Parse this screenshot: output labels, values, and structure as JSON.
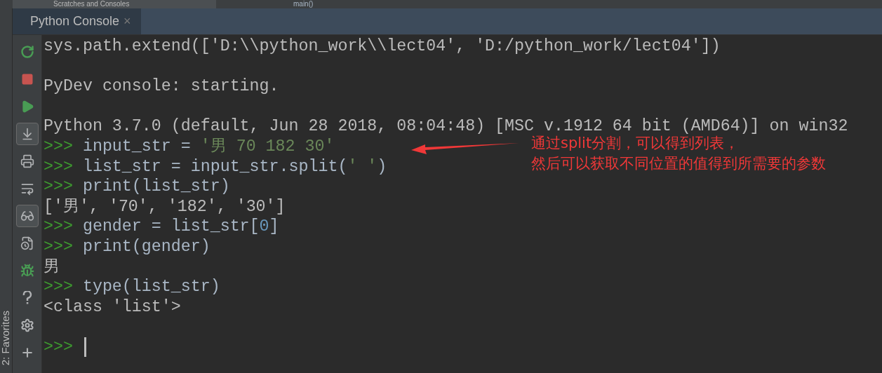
{
  "top_strip": {
    "tree_item": "Scratches and Consoles",
    "editor_text": "main()"
  },
  "tab": {
    "label": "Python Console",
    "close": "×",
    "selected": true
  },
  "toolbar": [
    {
      "kind": "rerun",
      "selected": false
    },
    {
      "kind": "stop",
      "selected": false
    },
    {
      "kind": "run",
      "selected": false
    },
    {
      "kind": "scroll-end",
      "selected": true
    },
    {
      "kind": "print",
      "selected": false
    },
    {
      "kind": "wrap",
      "selected": false
    },
    {
      "kind": "variables",
      "selected": true
    },
    {
      "kind": "history",
      "selected": false
    },
    {
      "kind": "debug",
      "selected": false
    },
    {
      "kind": "help",
      "selected": false
    },
    {
      "kind": "settings",
      "selected": false
    },
    {
      "kind": "add",
      "selected": false
    }
  ],
  "side_label": "2: Favorites",
  "console_blocks": [
    {
      "lines": [
        [
          {
            "kind": "output",
            "text": "sys.path.extend(['D:\\\\python_work\\\\lect04', 'D:/python_work/lect04'])"
          }
        ]
      ]
    },
    {
      "lines": [
        [
          {
            "kind": "output",
            "text": "PyDev console: starting."
          }
        ]
      ]
    },
    {
      "lines": [
        [
          {
            "kind": "output",
            "text": "Python 3.7.0 (default, Jun 28 2018, 08:04:48) [MSC v.1912 64 bit (AMD64)] on win32"
          }
        ],
        [
          {
            "kind": "prompt",
            "text": ">>>"
          },
          {
            "kind": "code",
            "text": " input_str = "
          },
          {
            "kind": "string",
            "text": "'男 70 182 30'"
          }
        ],
        [
          {
            "kind": "prompt",
            "text": ">>>"
          },
          {
            "kind": "code",
            "text": " list_str = input_str.split("
          },
          {
            "kind": "string",
            "text": "' '"
          },
          {
            "kind": "code",
            "text": ")"
          }
        ],
        [
          {
            "kind": "prompt",
            "text": ">>>"
          },
          {
            "kind": "code",
            "text": " print(list_str)"
          }
        ],
        [
          {
            "kind": "output",
            "text": "['男', '70', '182', '30']"
          }
        ],
        [
          {
            "kind": "prompt",
            "text": ">>>"
          },
          {
            "kind": "code",
            "text": " gender = list_str["
          },
          {
            "kind": "number",
            "text": "0"
          },
          {
            "kind": "code",
            "text": "]"
          }
        ],
        [
          {
            "kind": "prompt",
            "text": ">>>"
          },
          {
            "kind": "code",
            "text": " print(gender)"
          }
        ],
        [
          {
            "kind": "output",
            "text": "男"
          }
        ],
        [
          {
            "kind": "prompt",
            "text": ">>>"
          },
          {
            "kind": "code",
            "text": " type(list_str)"
          }
        ],
        [
          {
            "kind": "output",
            "text": "<class 'list'>"
          }
        ]
      ]
    }
  ],
  "input_prompt": ">>>",
  "annotation": {
    "lines": [
      "通过split分割，可以得到列表，",
      "然后可以获取不同位置的值得到所需要的参数"
    ]
  }
}
